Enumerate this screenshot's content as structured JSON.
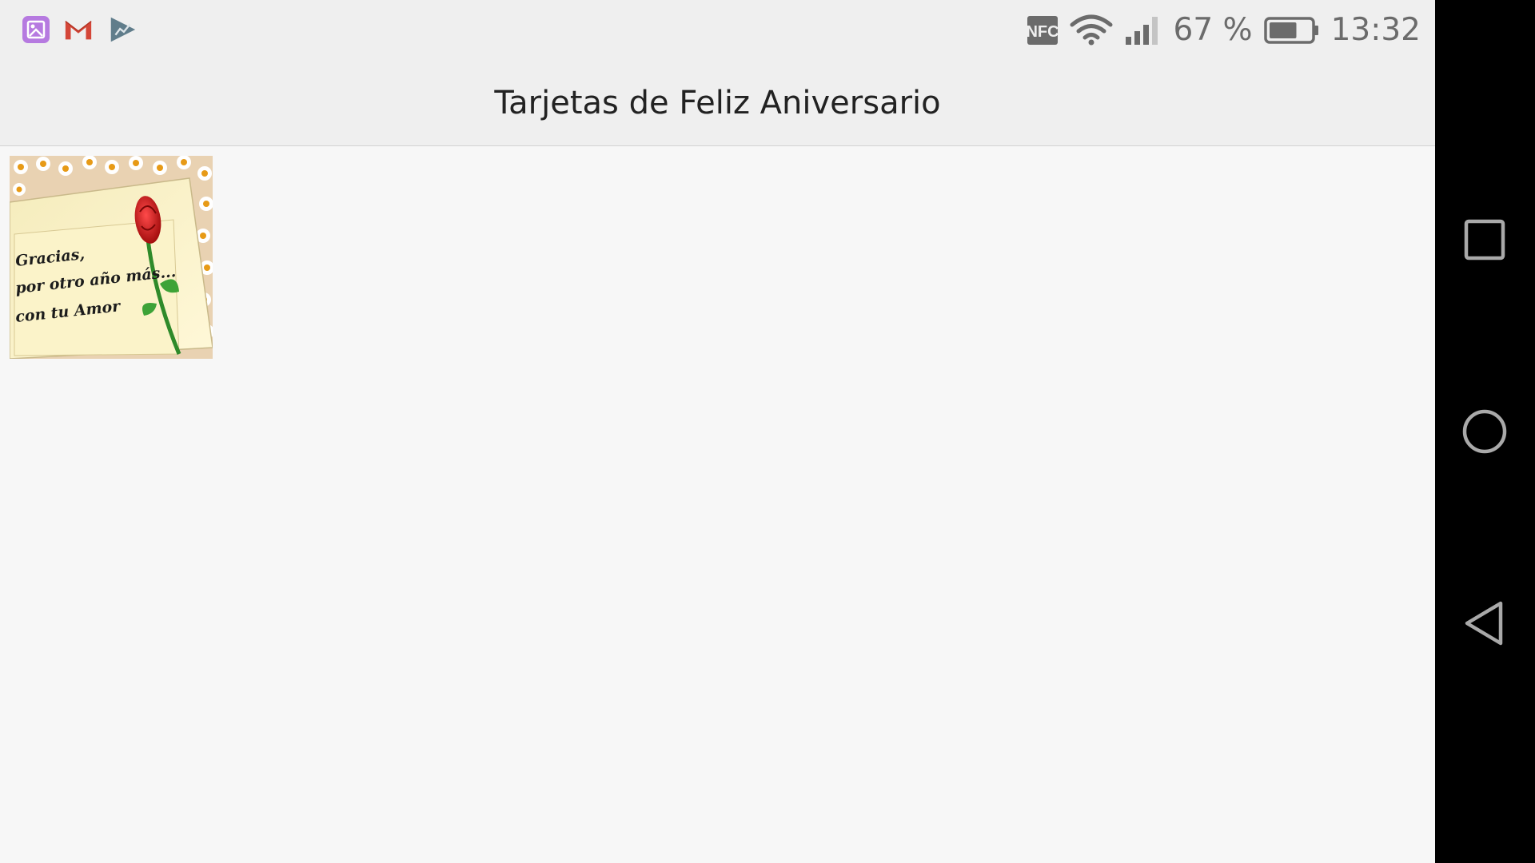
{
  "statusbar": {
    "notifications": [
      {
        "icon": "gallery-app-icon",
        "color": "#b67ae0"
      },
      {
        "icon": "gmail-icon",
        "color": "#d44638"
      },
      {
        "icon": "play-console-icon",
        "color": "#607d8b"
      }
    ],
    "nfc_label": "NFC",
    "battery_percent": "67 %",
    "battery_level": 0.67,
    "time": "13:32"
  },
  "titlebar": {
    "title": "Tarjetas de Feliz Aniversario"
  },
  "gallery": {
    "items": [
      {
        "caption_lines": [
          "Gracias,",
          "por otro año más...",
          "con tu Amor"
        ]
      }
    ]
  },
  "navigation": {
    "buttons": [
      "recents-button",
      "home-button",
      "back-button"
    ]
  },
  "colors": {
    "background": "#f7f7f7",
    "bar": "#efefef",
    "nav": "#000000",
    "status_icon": "#6b6b6b"
  }
}
